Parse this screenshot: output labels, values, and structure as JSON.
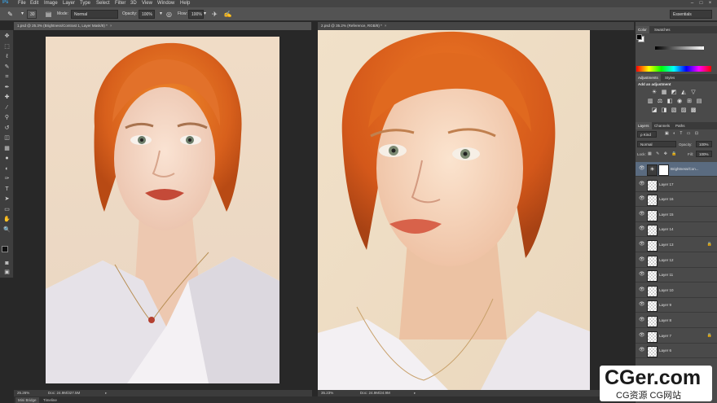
{
  "menubar": {
    "logo": "Ps",
    "items": [
      "File",
      "Edit",
      "Image",
      "Layer",
      "Type",
      "Select",
      "Filter",
      "3D",
      "View",
      "Window",
      "Help"
    ],
    "window_controls": [
      "–",
      "□",
      "×"
    ]
  },
  "options": {
    "brush_size": "30",
    "mode_label": "Mode:",
    "mode_value": "Normal",
    "opacity_label": "Opacity:",
    "opacity_value": "100%",
    "flow_label": "Flow:",
    "flow_value": "100%",
    "workspace": "Essentials"
  },
  "tabs": {
    "doc1": "1.psd @ 25.3% (Brightness/Contrast 1, Layer Mask/8) *",
    "doc2": "2.psd @ 35.2% (Reference, RGB/8) *",
    "close": "×"
  },
  "toolbar": {
    "tools": [
      "move-tool",
      "marquee-tool",
      "lasso-tool",
      "quick-select-tool",
      "crop-tool",
      "eyedropper-tool",
      "healing-tool",
      "brush-tool",
      "stamp-tool",
      "history-brush-tool",
      "eraser-tool",
      "gradient-tool",
      "blur-tool",
      "dodge-tool",
      "pen-tool",
      "type-tool",
      "path-select-tool",
      "shape-tool",
      "hand-tool",
      "zoom-tool"
    ],
    "glyphs": [
      "✥",
      "⬚",
      "ℓ",
      "✎",
      "⌗",
      "✒",
      "✚",
      "⁄",
      "⚲",
      "↺",
      "◫",
      "▦",
      "●",
      "◐",
      "✑",
      "T",
      "➤",
      "▭",
      "✋",
      "🔍"
    ]
  },
  "status": {
    "doc1_zoom": "25.26%",
    "doc1_info": "Doc: 24.9M/327.5M",
    "doc2_zoom": "35.23%",
    "doc2_info": "Doc: 24.9M/24.9M"
  },
  "bottom_tabs": [
    "Mini Bridge",
    "Timeline"
  ],
  "color_panel": {
    "tabs": [
      "Color",
      "Swatches"
    ],
    "slider_value": "0"
  },
  "adjustments": {
    "tabs": [
      "Adjustments",
      "Styles"
    ],
    "title": "Add an adjustment",
    "row1": [
      "☀",
      "▦",
      "◩",
      "◭",
      "▽"
    ],
    "row2": [
      "▥",
      "⚖",
      "◧",
      "◉",
      "⊞",
      "▤"
    ],
    "row3": [
      "◪",
      "◨",
      "▧",
      "▨",
      "▩"
    ]
  },
  "layers_panel": {
    "tabs": [
      "Layers",
      "Channels",
      "Paths"
    ],
    "filter_label": "ρ Kind",
    "blend_mode": "Normal",
    "opacity_label": "Opacity:",
    "opacity_value": "100%",
    "lock_label": "Lock:",
    "fill_label": "Fill:",
    "fill_value": "100%",
    "layers": [
      {
        "name": "Brightness/Con...",
        "adjustment": true
      },
      {
        "name": "Layer 17",
        "locked": false
      },
      {
        "name": "Layer 16",
        "locked": false
      },
      {
        "name": "Layer 15",
        "locked": false
      },
      {
        "name": "Layer 14",
        "locked": false
      },
      {
        "name": "Layer 13",
        "locked": true
      },
      {
        "name": "Layer 12",
        "locked": false
      },
      {
        "name": "Layer 11",
        "locked": false
      },
      {
        "name": "Layer 10",
        "locked": false
      },
      {
        "name": "Layer 9",
        "locked": false
      },
      {
        "name": "Layer 8",
        "locked": false
      },
      {
        "name": "Layer 7",
        "locked": true
      },
      {
        "name": "Layer 6",
        "locked": false
      }
    ]
  },
  "watermark": {
    "title": "CGer.com",
    "subtitle": "CG资源 CG网站"
  },
  "colors": {
    "ui_dark": "#282828",
    "panel": "#4a4a4a",
    "accent": "#3b9bd8",
    "hair": "#d9661f",
    "skin": "#f2d2bb"
  }
}
